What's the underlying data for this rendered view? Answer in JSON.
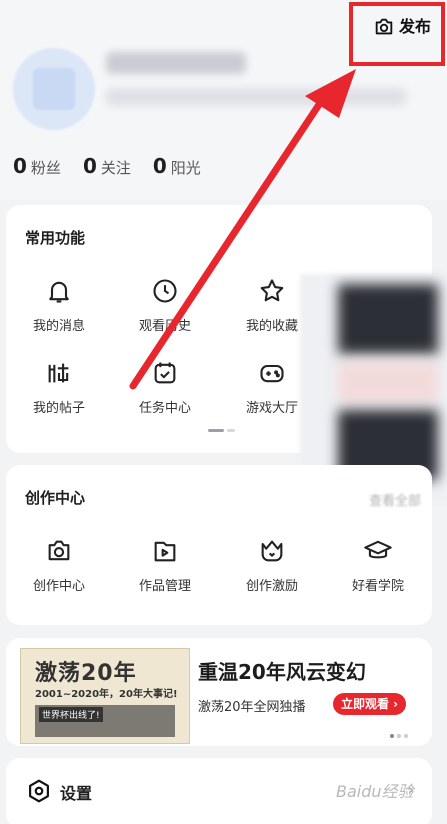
{
  "header": {
    "publish_label": "发布",
    "publish_icon": "camera-icon",
    "stats": [
      {
        "num": "0",
        "label": "粉丝"
      },
      {
        "num": "0",
        "label": "关注"
      },
      {
        "num": "0",
        "label": "阳光"
      }
    ]
  },
  "common": {
    "title": "常用功能",
    "items": [
      {
        "label": "我的消息",
        "icon": "bell-icon"
      },
      {
        "label": "观看历史",
        "icon": "clock-icon"
      },
      {
        "label": "我的收藏",
        "icon": "star-icon"
      },
      {
        "label": "我的帖子",
        "icon": "post-icon"
      },
      {
        "label": "任务中心",
        "icon": "calendar-check-icon"
      },
      {
        "label": "游戏大厅",
        "icon": "gamepad-icon"
      }
    ]
  },
  "creation": {
    "title": "创作中心",
    "more_label": "查看全部",
    "items": [
      {
        "label": "创作中心",
        "icon": "camera-icon"
      },
      {
        "label": "作品管理",
        "icon": "video-play-icon"
      },
      {
        "label": "创作激励",
        "icon": "crown-icon"
      },
      {
        "label": "好看学院",
        "icon": "graduation-cap-icon"
      }
    ]
  },
  "banner": {
    "poster_title": "激荡20年",
    "poster_sub": "2001~2020年，20年大事记!",
    "poster_tag": "世界杯出线了!",
    "headline": "重温20年风云变幻",
    "subline": "激荡20年全网独播",
    "cta": "立即观看 ›"
  },
  "settings": {
    "label": "设置",
    "chevron": "›"
  },
  "watermark": "Baidu经验",
  "colors": {
    "accent_red": "#e8262e",
    "card_bg": "#ffffff",
    "page_bg": "#f2f3f5"
  }
}
